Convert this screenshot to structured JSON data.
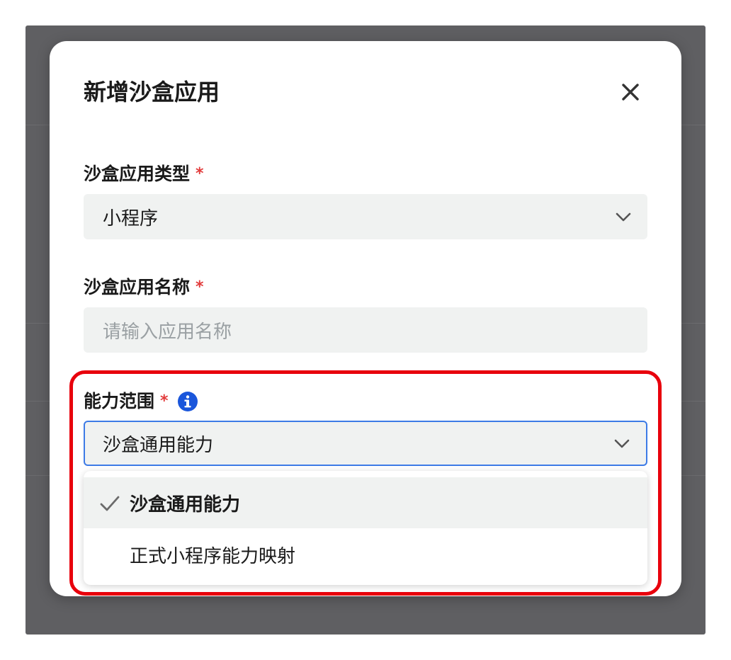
{
  "dialog": {
    "title": "新增沙盒应用"
  },
  "fields": {
    "app_type": {
      "label": "沙盒应用类型",
      "required_mark": "*",
      "value": "小程序"
    },
    "app_name": {
      "label": "沙盒应用名称",
      "required_mark": "*",
      "value": "",
      "placeholder": "请输入应用名称"
    },
    "scope": {
      "label": "能力范围",
      "required_mark": "*",
      "value": "沙盒通用能力",
      "options": [
        {
          "label": "沙盒通用能力",
          "selected": true
        },
        {
          "label": "正式小程序能力映射",
          "selected": false
        }
      ]
    }
  },
  "colors": {
    "required": "#e23c3c",
    "info": "#1a56db",
    "focus_border": "#3d7be6",
    "highlight_frame": "#e8000c"
  },
  "icons": {
    "close": "close-icon",
    "chevron": "chevron-down-icon",
    "info": "info-icon",
    "check": "check-icon"
  }
}
